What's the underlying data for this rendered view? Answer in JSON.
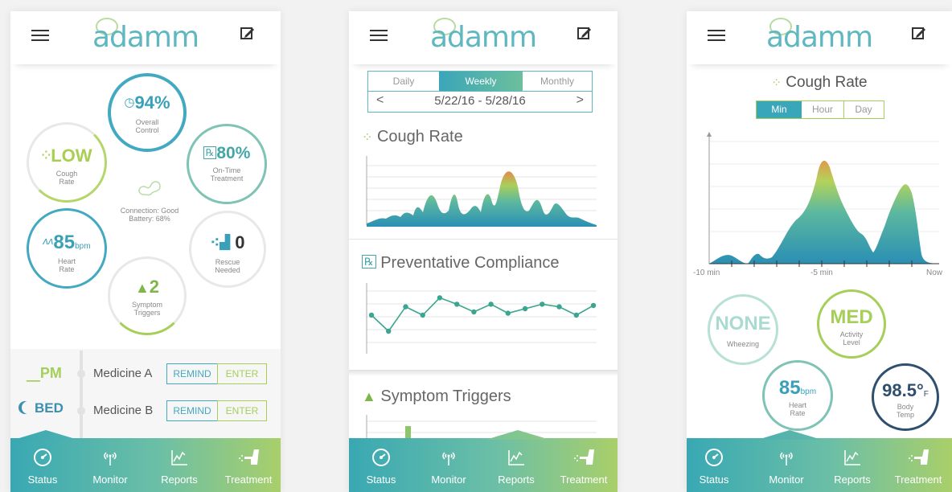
{
  "app": {
    "logo": "adamm"
  },
  "tabs": [
    {
      "label": "Status",
      "icon": "gauge-icon"
    },
    {
      "label": "Monitor",
      "icon": "signal-icon"
    },
    {
      "label": "Reports",
      "icon": "chart-icon"
    },
    {
      "label": "Treatment",
      "icon": "inhaler-icon"
    }
  ],
  "status": {
    "overall_value": "94%",
    "overall_label1": "Overall",
    "overall_label2": "Control",
    "cough_value": "LOW",
    "cough_label1": "Cough",
    "cough_label2": "Rate",
    "ontime_value": "80%",
    "ontime_label1": "On-Time",
    "ontime_label2": "Treatment",
    "connection": "Connection: Good",
    "battery": "Battery: 68%",
    "heart_value": "85",
    "heart_unit": "bpm",
    "heart_label1": "Heart",
    "heart_label2": "Rate",
    "rescue_value": "0",
    "rescue_label1": "Rescue",
    "rescue_label2": "Needed",
    "triggers_value": "2",
    "triggers_label1": "Symptom",
    "triggers_label2": "Triggers",
    "medicines": [
      {
        "time": "PM",
        "name": "Medicine A",
        "remind": "REMIND",
        "enter": "ENTER"
      },
      {
        "time": "BED",
        "name": "Medicine B",
        "remind": "REMIND",
        "enter": "ENTER"
      }
    ]
  },
  "reports": {
    "periods": [
      "Daily",
      "Weekly",
      "Monthly"
    ],
    "selected_period": "Weekly",
    "date_range": "5/22/16 - 5/28/16",
    "prev": "<",
    "next": ">",
    "cough_title": "Cough Rate",
    "compliance_title": "Preventative Compliance",
    "triggers_title": "Symptom Triggers",
    "compliance_values": [
      0.55,
      0.3,
      0.68,
      0.55,
      0.82,
      0.72,
      0.6,
      0.72,
      0.58,
      0.65,
      0.72,
      0.68,
      0.55,
      0.7
    ]
  },
  "monitor": {
    "title": "Cough Rate",
    "ranges": [
      "Min",
      "Hour",
      "Day"
    ],
    "selected_range": "Min",
    "x_labels": [
      "-10 min",
      "-5 min",
      "Now"
    ],
    "wheezing_value": "NONE",
    "wheezing_label": "Wheezing",
    "activity_value": "MED",
    "activity_label1": "Activity",
    "activity_label2": "Level",
    "heart_value": "85",
    "heart_unit": "bpm",
    "heart_label1": "Heart",
    "heart_label2": "Rate",
    "temp_value": "98.5°",
    "temp_unit": "F",
    "temp_label1": "Body",
    "temp_label2": "Temp"
  },
  "colors": {
    "teal": "#3aa6b9",
    "green": "#a6cf5a",
    "navy": "#2f4f6e",
    "orange": "#e0894a"
  }
}
